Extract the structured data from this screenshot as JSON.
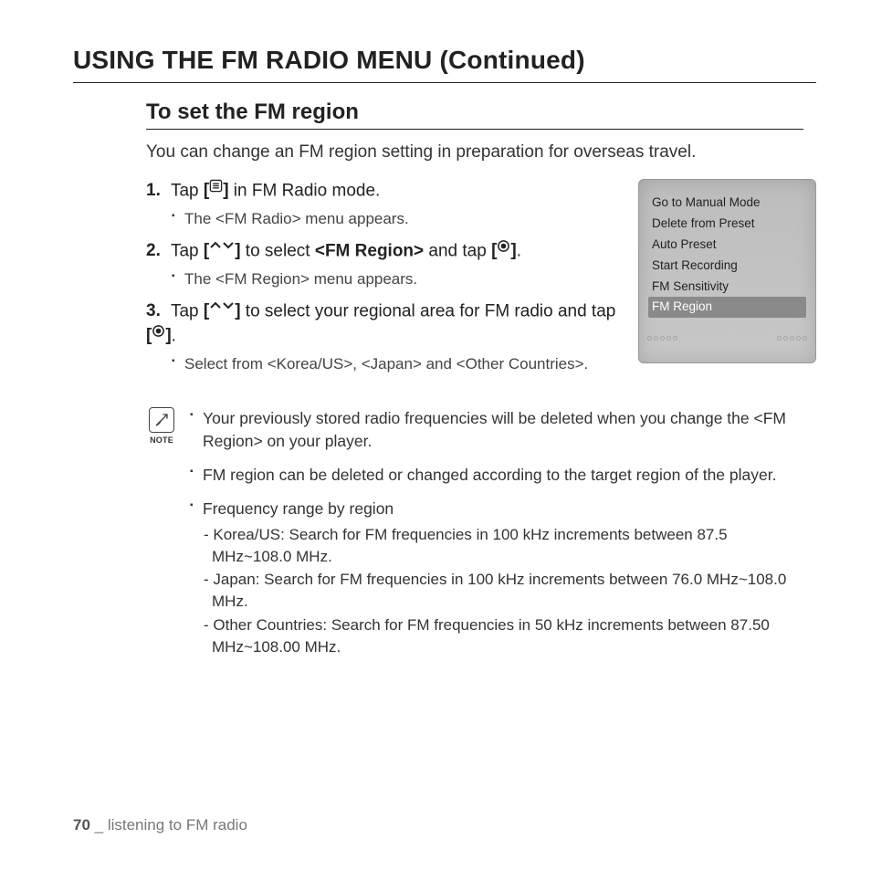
{
  "title": "USING THE FM RADIO MENU (Continued)",
  "section_title": "To set the FM region",
  "intro": "You can change an FM region setting in preparation for overseas travel.",
  "steps": [
    {
      "num": "1.",
      "pre": "Tap ",
      "icon": "menu",
      "post": " in FM Radio mode.",
      "sub": [
        "The <FM Radio> menu appears."
      ]
    },
    {
      "num": "2.",
      "pre": "Tap ",
      "icon": "updown",
      "mid": " to select ",
      "bold": "<FM Region>",
      "mid2": " and tap ",
      "icon2": "select",
      "post": ".",
      "sub": [
        "The <FM Region> menu appears."
      ]
    },
    {
      "num": "3.",
      "pre": "Tap ",
      "icon": "updown",
      "mid": " to select your regional area for FM radio and tap ",
      "icon2": "select",
      "post": ".",
      "sub": [
        "Select from <Korea/US>, <Japan> and <Other Countries>."
      ]
    }
  ],
  "device_menu": [
    {
      "label": "Go to Manual Mode",
      "selected": false
    },
    {
      "label": "Delete from Preset",
      "selected": false
    },
    {
      "label": "Auto Preset",
      "selected": false
    },
    {
      "label": "Start Recording",
      "selected": false
    },
    {
      "label": "FM Sensitivity",
      "selected": false
    },
    {
      "label": "FM Region",
      "selected": true
    }
  ],
  "note_label": "NOTE",
  "notes": [
    "Your previously stored radio frequencies will be deleted when you change the <FM Region> on your player.",
    "FM region can be deleted or changed according to the target region of the player."
  ],
  "freq_heading": "Frequency range by region",
  "freq_items": [
    "Korea/US: Search for FM frequencies in 100 kHz increments between 87.5 MHz~108.0 MHz.",
    "Japan: Search for FM frequencies in 100 kHz increments between 76.0 MHz~108.0 MHz.",
    "Other Countries: Search for FM frequencies in 50 kHz increments between 87.50 MHz~108.00 MHz."
  ],
  "footer": {
    "page": "70",
    "sep": " _ ",
    "chapter": "listening to FM radio"
  }
}
